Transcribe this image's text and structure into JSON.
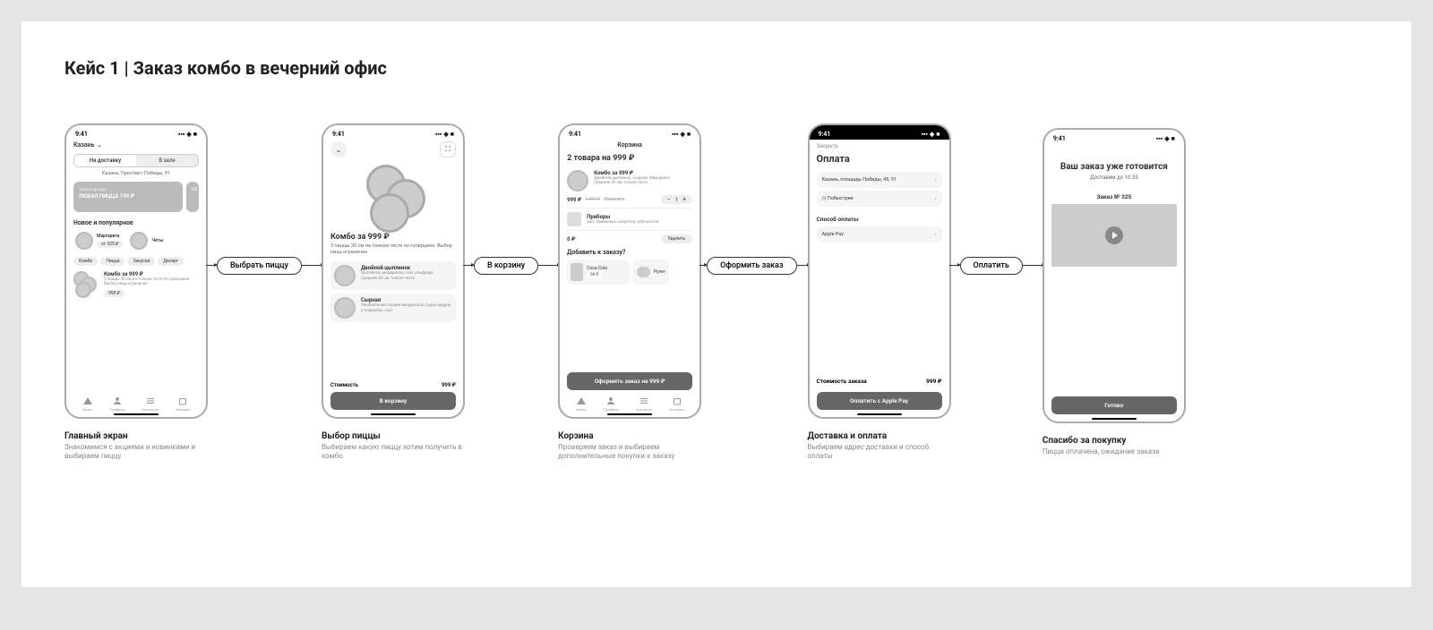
{
  "title": "Кейс 1 | Заказ  комбо в вечерний офис",
  "status_time": "9:41",
  "screens": {
    "home": {
      "city": "Казань",
      "toggle_delivery": "На доставку",
      "toggle_hall": "В зале",
      "address": "Казань, Проспект Победы, 91",
      "banner_tag": "ТОЛЬКО В КАФЕ",
      "banner_title": "ЛЮБАЯ ПИЦЦА 199 ₽",
      "banner2": "СК",
      "section_new": "Новое и популярное",
      "prod1_name": "Маргарита",
      "prod1_price": "от 325 ₽",
      "prod2_name": "Четы",
      "chips": [
        "Комбо",
        "Пицца",
        "Закуски",
        "Десерт"
      ],
      "combo_title": "Комбо за 999 ₽",
      "combo_desc": "3 пиццы 30 см на тонком тесте по суперцене. Выбор пицц ограничен",
      "combo_price": "999 ₽",
      "tabs": [
        "Меню",
        "Профиль",
        "Контакты",
        "Корзина"
      ],
      "caption_title": "Главный экран",
      "caption_desc": "Знакомимся с акциями и новинками и выбираем пиццу"
    },
    "select": {
      "heading": "Комбо за 999 ₽",
      "sub": "3 пиццы 30 см на тонком тесте по суперцене. Выбор пицц ограничен",
      "opt1_name": "Двойной цыпленок",
      "opt1_desc": "Цыпленок, моцарелла, соус альфредо",
      "opt1_size": "Средняя 30 см, тонкое тесто",
      "opt2_name": "Сырная",
      "opt2_desc": "Увеличенная порция моцареллы, сыры чеддер и пармезан, соус",
      "cost_label": "Стоимость",
      "cost_value": "999 ₽",
      "btn": "В корзину",
      "caption_title": "Выбор пиццы",
      "caption_desc": "Выбираем какую пиццу хотим получить в комбо"
    },
    "cart": {
      "top_title": "Корзина",
      "heading": "2 товара на 999  ₽",
      "item_name": "Комбо за 999 ₽",
      "item_sub1": "Двойной цыпленок, Сырная, Маргарита",
      "item_sub2": "Средняя 30 см, тонкое тесто",
      "price_now": "999 ₽",
      "price_old": "1 397 ₽",
      "change": "Изменить",
      "qty": "1",
      "cutlery_name": "Приборы",
      "cutlery_desc": "3шт, бумажные салфетки, зубочистки",
      "cutlery_price": "0 ₽",
      "delete": "Удалить",
      "upsell_heading": "Добавить к заказу?",
      "upsell1": "Coca Cola",
      "upsell1_price": "90 ₽",
      "upsell2": "Рулет",
      "btn": "Оформить заказ на 999 ₽",
      "tabs": [
        "Меню",
        "Профиль",
        "Контакты",
        "Корзина"
      ],
      "caption_title": "Корзина",
      "caption_desc": "Проверяем заказ и выбираем дополнительные покупки к заказу"
    },
    "payment": {
      "close": "Закрыть",
      "heading": "Оплата",
      "address": "Казань, площадь Победы, 45, 91",
      "speed": "Побыстрее",
      "method_label": "Способ оплаты",
      "method": "Apple Pay",
      "total_label": "Стоимость заказа",
      "total_value": "999 ₽",
      "btn": "Оплатить с Apple Pay",
      "caption_title": "Доставка и оплата",
      "caption_desc": "Выбираем адрес доставки и способ оплаты"
    },
    "thanks": {
      "heading": "Ваш заказ уже готовится",
      "sub": "Доставим до 10:35",
      "order": "Заказ № 325",
      "btn": "Готово",
      "caption_title": "Спасибо за покупку",
      "caption_desc": "Пицца оплачена, ожидание заказа"
    }
  },
  "connectors": {
    "c1": "Выбрать пиццу",
    "c2": "В корзину",
    "c3": "Оформить заказ",
    "c4": "Оплатить"
  }
}
